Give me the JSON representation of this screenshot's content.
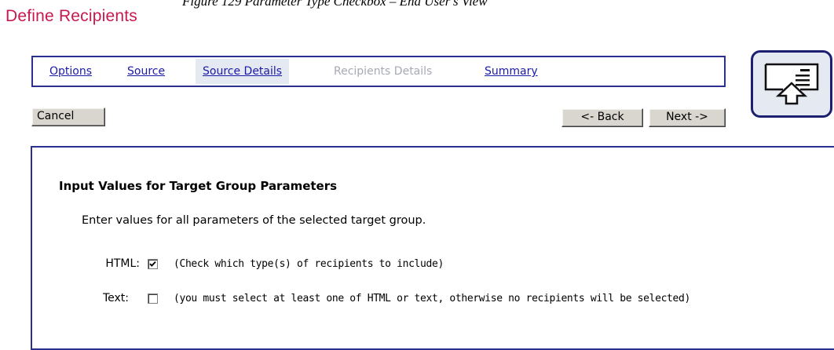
{
  "caption": "Figure 129  Parameter Type Checkbox – End User's View",
  "page_title": "Define Recipients",
  "tabs": [
    {
      "label": "Options",
      "state": "link"
    },
    {
      "label": "Source",
      "state": "link"
    },
    {
      "label": "Source Details",
      "state": "active"
    },
    {
      "label": "Recipients Details",
      "state": "disabled"
    },
    {
      "label": "Summary",
      "state": "link"
    }
  ],
  "buttons": {
    "cancel": "Cancel",
    "back": "<- Back",
    "next": "Next ->"
  },
  "logo_icon": "recipients-card-icon",
  "form": {
    "heading": "Input Values for Target Group Parameters",
    "intro": "Enter values for all parameters of the selected target group.",
    "fields": [
      {
        "label": "HTML:",
        "checked": true,
        "note": "(Check which type(s) of recipients to include)"
      },
      {
        "label": "Text:",
        "checked": false,
        "note": "(you must select at least one of HTML or text, otherwise no recipients will be selected)"
      }
    ]
  },
  "colors": {
    "title": "#c8194f",
    "border": "#2b2f8f",
    "link": "#1a1aa6",
    "disabled": "#a7a9b3",
    "active_tab_bg": "#e5e9f2"
  }
}
